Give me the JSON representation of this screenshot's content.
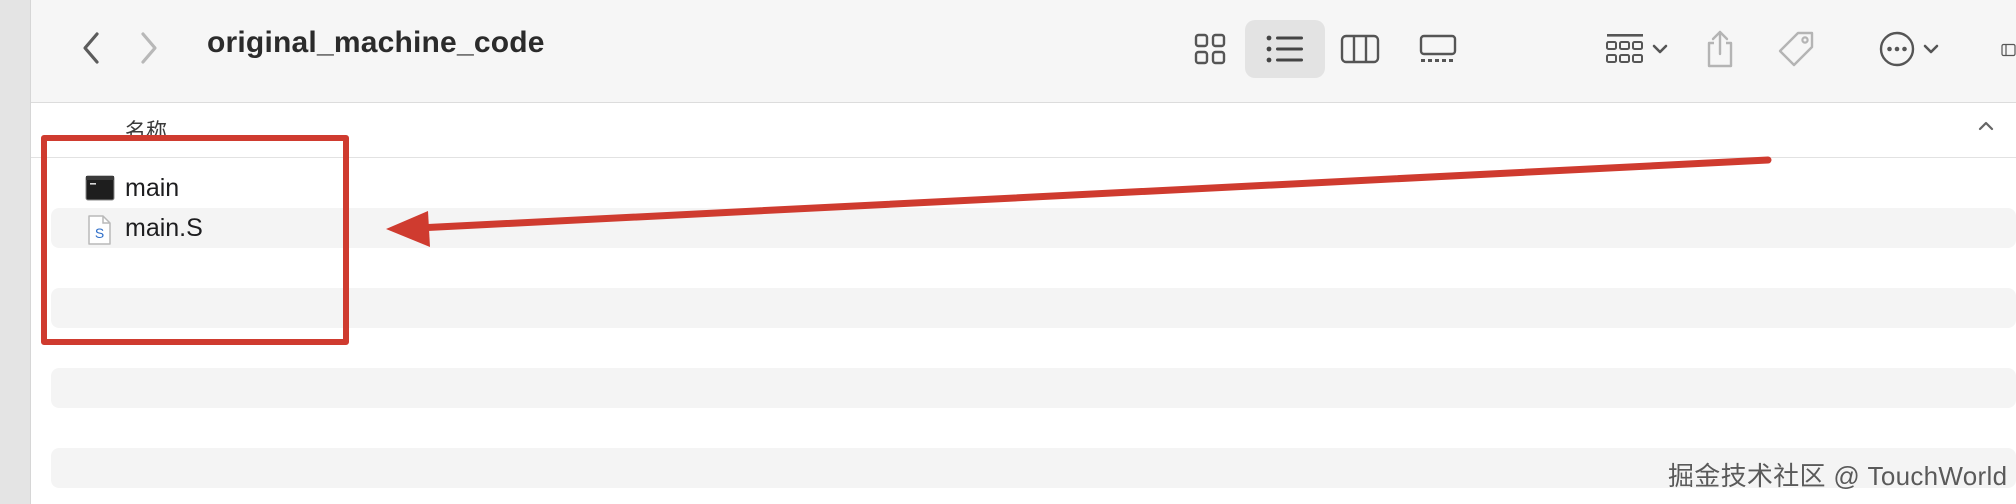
{
  "window": {
    "title": "original_machine_code"
  },
  "toolbar": {
    "back_icon": "chevron-left-icon",
    "forward_icon": "chevron-right-icon",
    "views": [
      "icon-view-icon",
      "list-view-icon",
      "column-view-icon",
      "gallery-view-icon"
    ],
    "selected_view": "list-view-icon",
    "actions": [
      "group-icon",
      "share-icon",
      "tag-icon",
      "more-icon"
    ]
  },
  "columns": {
    "name": "名称",
    "sort_icon": "chevron-up-icon"
  },
  "files": [
    {
      "name": "main",
      "icon": "terminal-exec-icon"
    },
    {
      "name": "main.S",
      "icon": "asm-source-icon",
      "icon_letter": "S"
    }
  ],
  "annotations": {
    "highlight_color": "#cf3b2f"
  },
  "watermark": "掘金技术社区 @ TouchWorld"
}
